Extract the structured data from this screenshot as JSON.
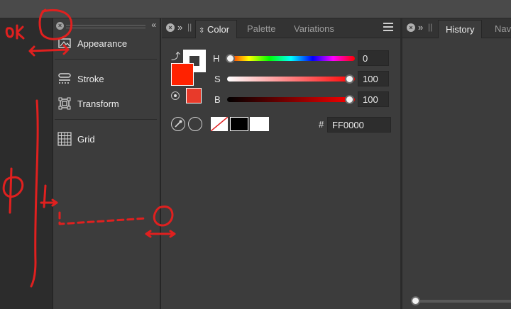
{
  "left_panel": {
    "items": [
      {
        "label": "Appearance",
        "icon": "appearance-icon"
      },
      {
        "label": "Stroke",
        "icon": "stroke-icon"
      },
      {
        "label": "Transform",
        "icon": "transform-icon"
      },
      {
        "label": "Grid",
        "icon": "grid-icon"
      }
    ]
  },
  "color_panel": {
    "tabs": [
      {
        "label": "Color",
        "active": true
      },
      {
        "label": "Palette",
        "active": false
      },
      {
        "label": "Variations",
        "active": false
      }
    ],
    "sliders": {
      "h": {
        "label": "H",
        "value": "0"
      },
      "s": {
        "label": "S",
        "value": "100"
      },
      "b": {
        "label": "B",
        "value": "100"
      }
    },
    "hex": {
      "prefix": "#",
      "value": "FF0000"
    },
    "colors": {
      "fill": "#ff2200",
      "stroke": "#ffffff",
      "accent": "#e83a2a"
    }
  },
  "history_panel": {
    "tabs": [
      {
        "label": "History",
        "active": true
      },
      {
        "label": "Nav",
        "active": false
      }
    ]
  }
}
